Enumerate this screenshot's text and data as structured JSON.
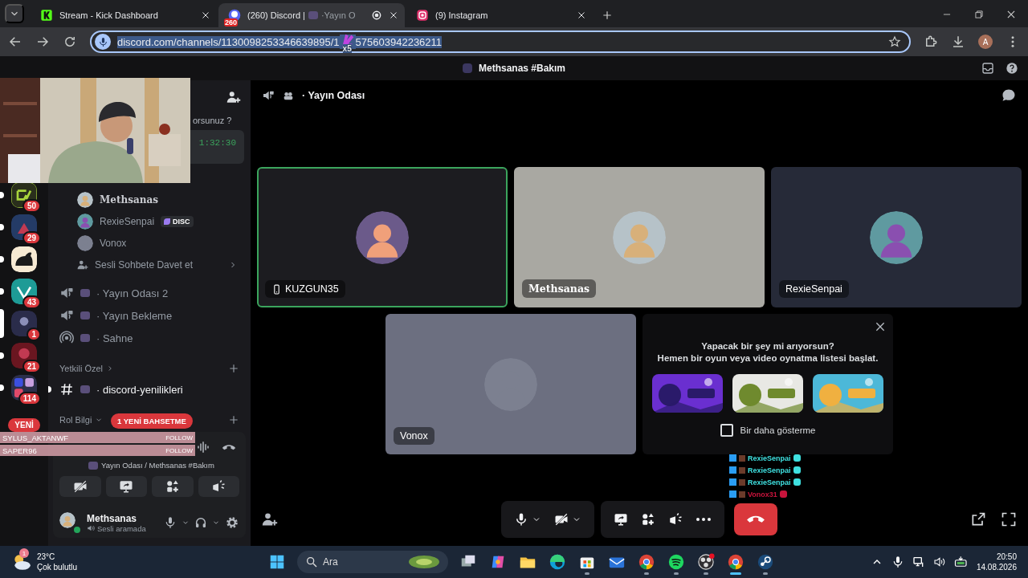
{
  "browser": {
    "tabs": [
      {
        "title": "Stream - Kick Dashboard",
        "kind": "kick",
        "selected": false
      },
      {
        "title": "(260) Discord | ",
        "title_tail": "·Yayın O",
        "favicon_badge": "260",
        "kind": "discord",
        "selected": true
      },
      {
        "title": "(9) Instagram",
        "kind": "instagram",
        "selected": false
      }
    ],
    "url_start": "discord.com/channels/1130098253346639895/1",
    "url_end": "575603942236211",
    "sticker_count": "x5",
    "profile": "A"
  },
  "header": {
    "title": "Methsanas #Bakım"
  },
  "servers": [
    {
      "badge": "50",
      "kind": "gv",
      "unread": true,
      "selected": false
    },
    {
      "badge": "29",
      "kind": "blue",
      "unread": true,
      "selected": false
    },
    {
      "kind": "cat",
      "unread": true,
      "selected": false
    },
    {
      "badge": "43",
      "kind": "teal",
      "unread": true,
      "selected": false
    },
    {
      "badge": "1",
      "kind": "navy",
      "selected": true
    },
    {
      "badge": "21",
      "kind": "red",
      "unread": true,
      "selected": false
    },
    {
      "badge": "114",
      "kind": "folder",
      "unread": true,
      "selected": false
    }
  ],
  "new_pill": "YENİ",
  "sidebar": {
    "snippet": "orsunuz ?",
    "timer": "1:32:30",
    "voice_members": [
      {
        "name": "Methsanas",
        "kind": "fancy"
      },
      {
        "name": "RexieSenpai",
        "tag": "DISC",
        "kind": "plain"
      },
      {
        "name": "Vonox",
        "kind": "plain"
      }
    ],
    "invite": "Sesli Sohbete Davet et",
    "channels": [
      {
        "name": "· Yayın Odası 2",
        "kind": "voice"
      },
      {
        "name": "· Yayın Bekleme",
        "kind": "voice"
      },
      {
        "name": "· Sahne",
        "kind": "stage"
      }
    ],
    "categories": [
      {
        "name": "Yetkili Özel",
        "expanded": false,
        "channels": [
          {
            "name": "· discord-yenilikleri",
            "unread": true
          }
        ]
      },
      {
        "name": "Rol Bilgi",
        "expanded": true
      }
    ],
    "mention_pill": "1 YENİ BAHSETME"
  },
  "stream_alerts": [
    {
      "user": "SYLUS_AKTANWF",
      "action": "FOLLOW"
    },
    {
      "user": "SAPER96",
      "action": "FOLLOW"
    }
  ],
  "voice_panel": {
    "location": "Yayın Odası / Methsanas #Bakım",
    "user": {
      "name": "Methsanas",
      "status": "Sesli aramada"
    }
  },
  "call": {
    "channel": "· Yayın Odası",
    "tiles": [
      {
        "name": "KUZGUN35",
        "mobile": true,
        "speaking": true,
        "kind": "plain",
        "color": "#1c1c20"
      },
      {
        "name": "Methsanas",
        "mobile": false,
        "speaking": false,
        "kind": "fancy",
        "color": "#a9a8a2"
      },
      {
        "name": "RexieSenpai",
        "mobile": false,
        "speaking": false,
        "kind": "plain",
        "color": "#262a38"
      },
      {
        "name": "Vonox",
        "mobile": false,
        "speaking": false,
        "kind": "plain",
        "color": "#6c6f80"
      }
    ],
    "activity": {
      "title": "Yapacak bir şey mi arıyorsun?",
      "subtitle": "Hemen bir oyun veya video oynatma listesi başlat.",
      "checkbox": {
        "label": "Bir daha gösterme",
        "checked": false
      }
    }
  },
  "chat_overlay": [
    {
      "user": "RexieSenpai",
      "color": "#3fe0e0"
    },
    {
      "user": "RexieSenpai",
      "color": "#3fe0e0"
    },
    {
      "user": "RexieSenpai",
      "color": "#3fe0e0"
    },
    {
      "user": "Vonox31",
      "color": "#c8143c"
    }
  ],
  "taskbar": {
    "weather": {
      "temp": "23°C",
      "desc": "Çok bulutlu",
      "badge": "1"
    },
    "search": {
      "placeholder": "Ara"
    },
    "apps": [
      {
        "kind": "taskview",
        "running": false
      },
      {
        "kind": "copilot",
        "running": false
      },
      {
        "kind": "folder",
        "running": false
      },
      {
        "kind": "edge",
        "running": false
      },
      {
        "kind": "store",
        "running": true
      },
      {
        "kind": "mail",
        "running": false
      },
      {
        "kind": "chrome",
        "running": true
      },
      {
        "kind": "spotify",
        "running": true
      },
      {
        "kind": "obs",
        "running": true
      },
      {
        "kind": "chrome",
        "running": true
      },
      {
        "kind": "steam",
        "running": true
      }
    ],
    "time": "20:50",
    "date": "14.08.2026"
  }
}
